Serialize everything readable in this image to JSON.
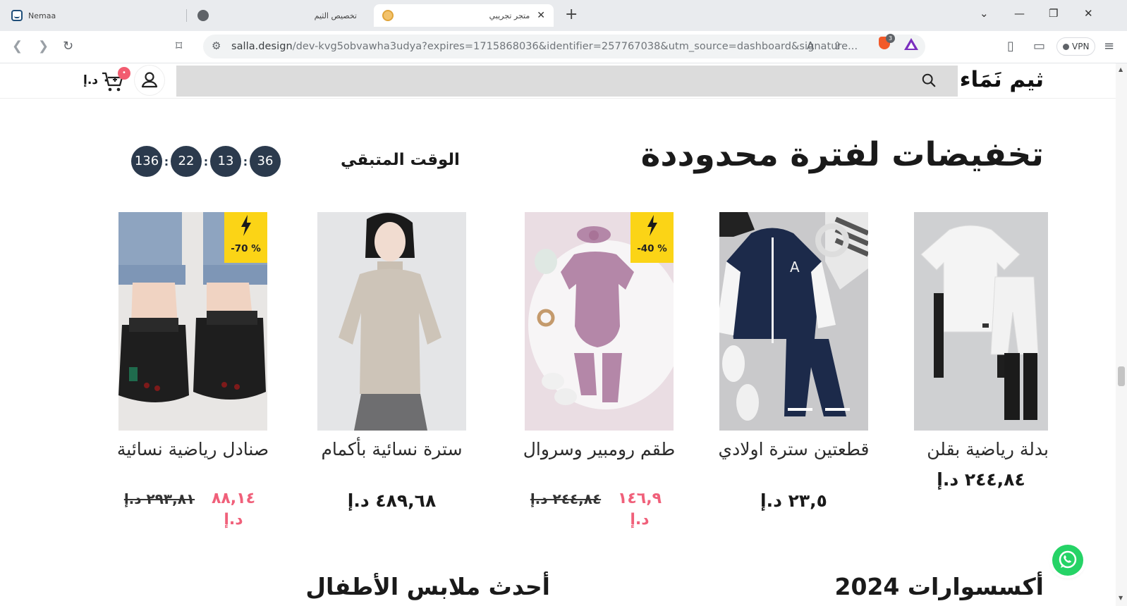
{
  "browser": {
    "tabs": [
      {
        "title": "Nemaa",
        "icon": "nemaa-favicon",
        "active": false
      },
      {
        "title": "تخصيص الثيم",
        "icon": "globe-icon",
        "active": false
      },
      {
        "title": "متجر تجريبي",
        "icon": "salla-favicon",
        "active": true
      }
    ],
    "new_tab": "+",
    "url_host": "salla.design",
    "url_rest": "/dev-kvg5obvawha3udya?expires=1715868036&identifier=257767038&utm_source=dashboard&signature...",
    "brave_badge": "3",
    "vpn_label": "VPN"
  },
  "header": {
    "logo": "ثيم نَمَاء",
    "cart_badge": "•",
    "cart_total": "٠ د.إ"
  },
  "offers": {
    "title": "تخفيضات لفترة محدوددة",
    "remaining_label": "الوقت المتبقي",
    "timer": [
      "136",
      "22",
      "13",
      "36"
    ],
    "products": [
      {
        "name": "بدلة رياضية بقلن",
        "price": "٢٤٤,٨٤ د.إ",
        "discount": ""
      },
      {
        "name": "قطعتين سترة اولادي",
        "price": "٢٣,٥ د.إ",
        "discount": ""
      },
      {
        "name": "طقم رومبير وسروال",
        "sale_price": "١٤٦,٩ د.إ",
        "old_price": "٢٤٤,٨٤ د.إ",
        "discount": "-40 %"
      },
      {
        "name": "سترة نسائية بأكمام",
        "price": "٤٨٩,٦٨ د.إ",
        "discount": ""
      },
      {
        "name": "صنادل رياضية نسائية",
        "sale_price": "٨٨,١٤ د.إ",
        "old_price": "٢٩٣,٨١ د.إ",
        "discount": "-70 %"
      }
    ]
  },
  "sections": {
    "accessories_title": "أكسسوارات 2024",
    "kids_title": "أحدث ملابس الأطفال"
  },
  "colors": {
    "timer_bg": "#2b3a4d",
    "discount_bg": "#fbd416",
    "sale_price": "#f0607a",
    "whatsapp": "#25d366"
  }
}
